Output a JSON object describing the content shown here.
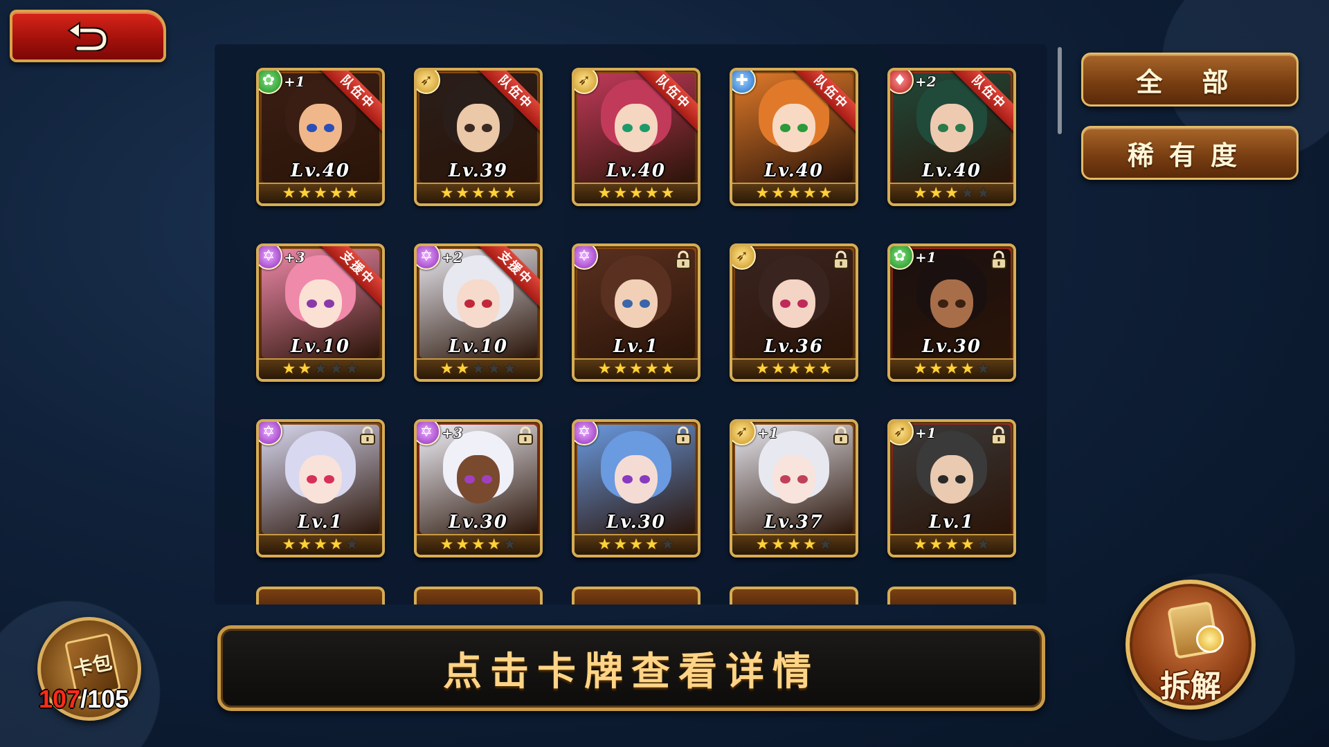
{
  "back_icon": "back-arrow-icon",
  "filters": {
    "all_label": "全 部",
    "rarity_label": "稀有度"
  },
  "cards": [
    {
      "level": "Lv.40",
      "stars": 5,
      "attribute": "green",
      "plus": "+1",
      "badge": "队伍中",
      "locked": false
    },
    {
      "level": "Lv.39",
      "stars": 5,
      "attribute": "gold",
      "plus": "",
      "badge": "队伍中",
      "locked": false
    },
    {
      "level": "Lv.40",
      "stars": 5,
      "attribute": "gold",
      "plus": "",
      "badge": "队伍中",
      "locked": false
    },
    {
      "level": "Lv.40",
      "stars": 5,
      "attribute": "blue",
      "plus": "",
      "badge": "队伍中",
      "locked": false
    },
    {
      "level": "Lv.40",
      "stars": 3,
      "attribute": "red",
      "plus": "+2",
      "badge": "队伍中",
      "locked": false
    },
    {
      "level": "Lv.10",
      "stars": 2,
      "attribute": "purple",
      "plus": "+3",
      "badge": "支援中",
      "locked": false
    },
    {
      "level": "Lv.10",
      "stars": 2,
      "attribute": "purple",
      "plus": "+2",
      "badge": "支援中",
      "locked": false
    },
    {
      "level": "Lv.1",
      "stars": 5,
      "attribute": "purple",
      "plus": "",
      "badge": "",
      "locked": true
    },
    {
      "level": "Lv.36",
      "stars": 5,
      "attribute": "gold",
      "plus": "",
      "badge": "",
      "locked": true
    },
    {
      "level": "Lv.30",
      "stars": 4,
      "attribute": "green",
      "plus": "+1",
      "badge": "",
      "locked": true
    },
    {
      "level": "Lv.1",
      "stars": 4,
      "attribute": "purple",
      "plus": "",
      "badge": "",
      "locked": true
    },
    {
      "level": "Lv.30",
      "stars": 4,
      "attribute": "purple",
      "plus": "+3",
      "badge": "",
      "locked": true
    },
    {
      "level": "Lv.30",
      "stars": 4,
      "attribute": "purple",
      "plus": "",
      "badge": "",
      "locked": true
    },
    {
      "level": "Lv.37",
      "stars": 4,
      "attribute": "gold",
      "plus": "+1",
      "badge": "",
      "locked": true
    },
    {
      "level": "Lv.1",
      "stars": 4,
      "attribute": "gold",
      "plus": "+1",
      "badge": "",
      "locked": true
    }
  ],
  "info_text": "点击卡牌查看详情",
  "pack": {
    "label": "卡包",
    "current": "107",
    "max": "/105"
  },
  "disassemble_label": "拆解",
  "colors": {
    "team_badge": "#c8261c",
    "gold_frame": "#d6ad55",
    "count_over": "#ff2a1a"
  }
}
